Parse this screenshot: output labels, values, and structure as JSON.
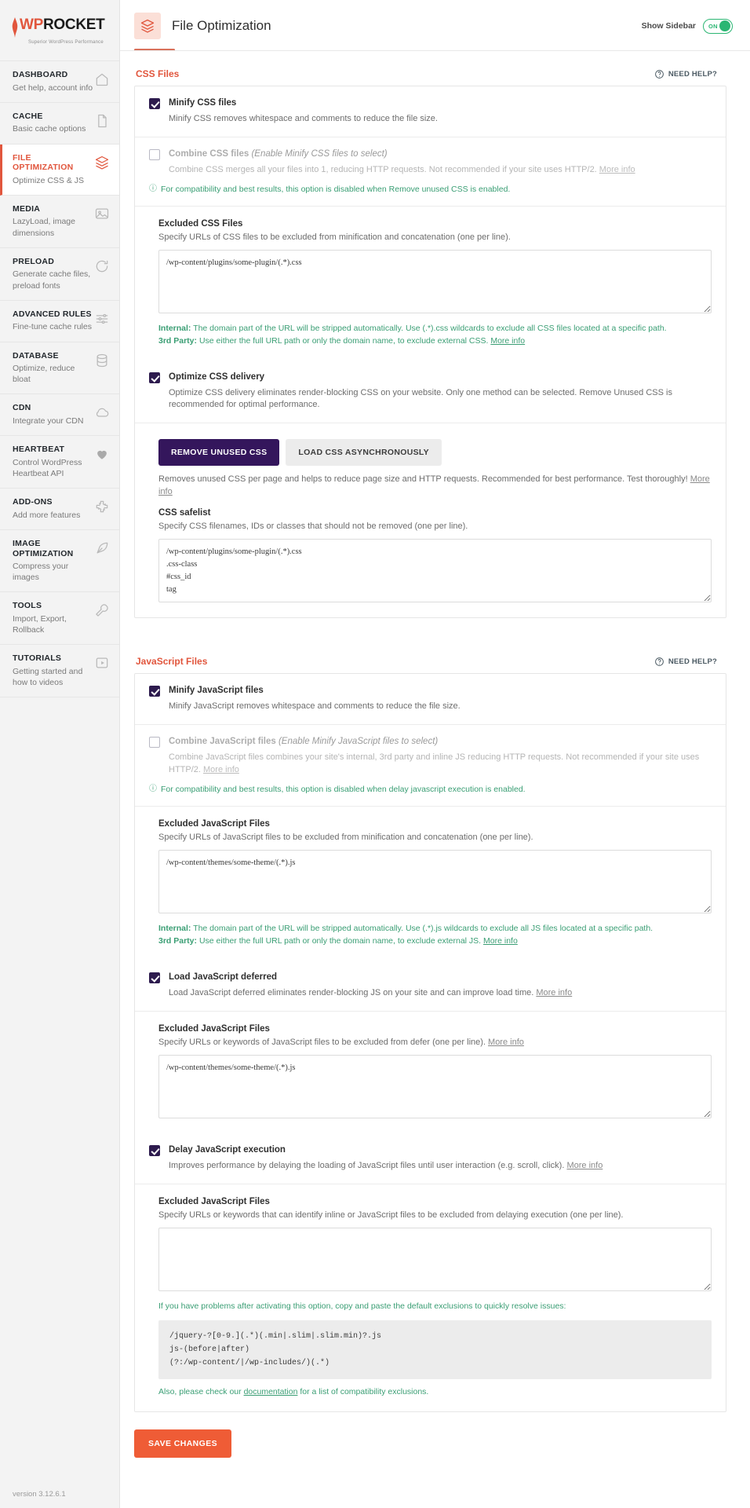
{
  "brand": {
    "name_wp": "WP",
    "name_rocket": "ROCKET",
    "tagline": "Superior WordPress Performance",
    "version": "version 3.12.6.1",
    "accent": "#e1563d",
    "purple": "#34165c",
    "green": "#2bb673",
    "save_orange": "#ef5c36"
  },
  "sidebar": {
    "items": [
      {
        "title": "DASHBOARD",
        "sub": "Get help, account info",
        "icon": "home-icon",
        "active": false
      },
      {
        "title": "CACHE",
        "sub": "Basic cache options",
        "icon": "file-icon",
        "active": false
      },
      {
        "title": "FILE OPTIMIZATION",
        "sub": "Optimize CSS & JS",
        "icon": "layers-icon",
        "active": true
      },
      {
        "title": "MEDIA",
        "sub": "LazyLoad, image dimensions",
        "icon": "image-icon",
        "active": false
      },
      {
        "title": "PRELOAD",
        "sub": "Generate cache files, preload fonts",
        "icon": "refresh-icon",
        "active": false
      },
      {
        "title": "ADVANCED RULES",
        "sub": "Fine-tune cache rules",
        "icon": "sliders-icon",
        "active": false
      },
      {
        "title": "DATABASE",
        "sub": "Optimize, reduce bloat",
        "icon": "database-icon",
        "active": false
      },
      {
        "title": "CDN",
        "sub": "Integrate your CDN",
        "icon": "cloud-icon",
        "active": false
      },
      {
        "title": "HEARTBEAT",
        "sub": "Control WordPress Heartbeat API",
        "icon": "heart-icon",
        "active": false
      },
      {
        "title": "ADD-ONS",
        "sub": "Add more features",
        "icon": "puzzle-icon",
        "active": false
      },
      {
        "title": "IMAGE OPTIMIZATION",
        "sub": "Compress your images",
        "icon": "feather-icon",
        "active": false
      },
      {
        "title": "TOOLS",
        "sub": "Import, Export, Rollback",
        "icon": "wrench-icon",
        "active": false
      },
      {
        "title": "TUTORIALS",
        "sub": "Getting started and how to videos",
        "icon": "play-icon",
        "active": false
      }
    ]
  },
  "header": {
    "title": "File Optimization",
    "icon": "layers-icon",
    "show_sidebar_label": "Show Sidebar",
    "toggle_state": "ON"
  },
  "css_section": {
    "title": "CSS Files",
    "need_help": "NEED HELP?",
    "minify": {
      "label": "Minify CSS files",
      "desc": "Minify CSS removes whitespace and comments to reduce the file size.",
      "checked": true
    },
    "combine": {
      "label": "Combine CSS files ",
      "label_hint": "(Enable Minify CSS files to select)",
      "desc": "Combine CSS merges all your files into 1, reducing HTTP requests. Not recommended if your site uses HTTP/2. ",
      "more_info": "More info",
      "notice": "For compatibility and best results, this option is disabled when Remove unused CSS is enabled.",
      "checked": false
    },
    "excluded": {
      "title": "Excluded CSS Files",
      "sub": "Specify URLs of CSS files to be excluded from minification and concatenation (one per line).",
      "value": "/wp-content/plugins/some-plugin/(.*).css",
      "help_internal_label": "Internal:",
      "help_internal": " The domain part of the URL will be stripped automatically. Use (.*).css wildcards to exclude all CSS files located at a specific path.",
      "help_third_label": "3rd Party:",
      "help_third": " Use either the full URL path or only the domain name, to exclude external CSS. ",
      "more_info": "More info"
    },
    "optimize_delivery": {
      "label": "Optimize CSS delivery",
      "desc": "Optimize CSS delivery eliminates render-blocking CSS on your website. Only one method can be selected. Remove Unused CSS is recommended for optimal performance.",
      "checked": true,
      "buttons": [
        {
          "label": "REMOVE UNUSED CSS",
          "active": true
        },
        {
          "label": "LOAD CSS ASYNCHRONOUSLY",
          "active": false
        }
      ],
      "buttons_desc": "Removes unused CSS per page and helps to reduce page size and HTTP requests. Recommended for best performance. Test thoroughly! ",
      "buttons_more": "More info",
      "safelist_title": "CSS safelist",
      "safelist_sub": "Specify CSS filenames, IDs or classes that should not be removed (one per line).",
      "safelist_value": "/wp-content/plugins/some-plugin/(.*).css\n.css-class\n#css_id\ntag"
    }
  },
  "js_section": {
    "title": "JavaScript Files",
    "need_help": "NEED HELP?",
    "minify": {
      "label": "Minify JavaScript files",
      "desc": "Minify JavaScript removes whitespace and comments to reduce the file size.",
      "checked": true
    },
    "combine": {
      "label": "Combine JavaScript files ",
      "label_hint": "(Enable Minify JavaScript files to select)",
      "desc": "Combine JavaScript files combines your site's internal, 3rd party and inline JS reducing HTTP requests. Not recommended if your site uses HTTP/2. ",
      "more_info": "More info",
      "notice": "For compatibility and best results, this option is disabled when delay javascript execution is enabled.",
      "checked": false
    },
    "excluded": {
      "title": "Excluded JavaScript Files",
      "sub": "Specify URLs of JavaScript files to be excluded from minification and concatenation (one per line).",
      "value": "/wp-content/themes/some-theme/(.*).js",
      "help_internal_label": "Internal:",
      "help_internal": " The domain part of the URL will be stripped automatically. Use (.*).js wildcards to exclude all JS files located at a specific path.",
      "help_third_label": "3rd Party:",
      "help_third": " Use either the full URL path or only the domain name, to exclude external JS. ",
      "more_info": "More info"
    },
    "defer": {
      "label": "Load JavaScript deferred",
      "desc": "Load JavaScript deferred eliminates render-blocking JS on your site and can improve load time. ",
      "more_info": "More info",
      "checked": true,
      "excluded_title": "Excluded JavaScript Files",
      "excluded_sub": "Specify URLs or keywords of JavaScript files to be excluded from defer (one per line). ",
      "excluded_more": "More info",
      "excluded_value": "/wp-content/themes/some-theme/(.*).js"
    },
    "delay": {
      "label": "Delay JavaScript execution",
      "desc": "Improves performance by delaying the loading of JavaScript files until user interaction (e.g. scroll, click). ",
      "more_info": "More info",
      "checked": true,
      "excluded_title": "Excluded JavaScript Files",
      "excluded_sub": "Specify URLs or keywords that can identify inline or JavaScript files to be excluded from delaying execution (one per line).",
      "excluded_value": "",
      "problems_text": "If you have problems after activating this option, copy and paste the default exclusions to quickly resolve issues:",
      "code": "/jquery-?[0-9.](.*)(.min|.slim|.slim.min)?.js\njs-(before|after)\n(?:/wp-content/|/wp-includes/)(.*)",
      "doc_prefix": "Also, please check our ",
      "doc_link": "documentation",
      "doc_suffix": " for a list of compatibility exclusions."
    }
  },
  "footer": {
    "save_label": "SAVE CHANGES"
  }
}
